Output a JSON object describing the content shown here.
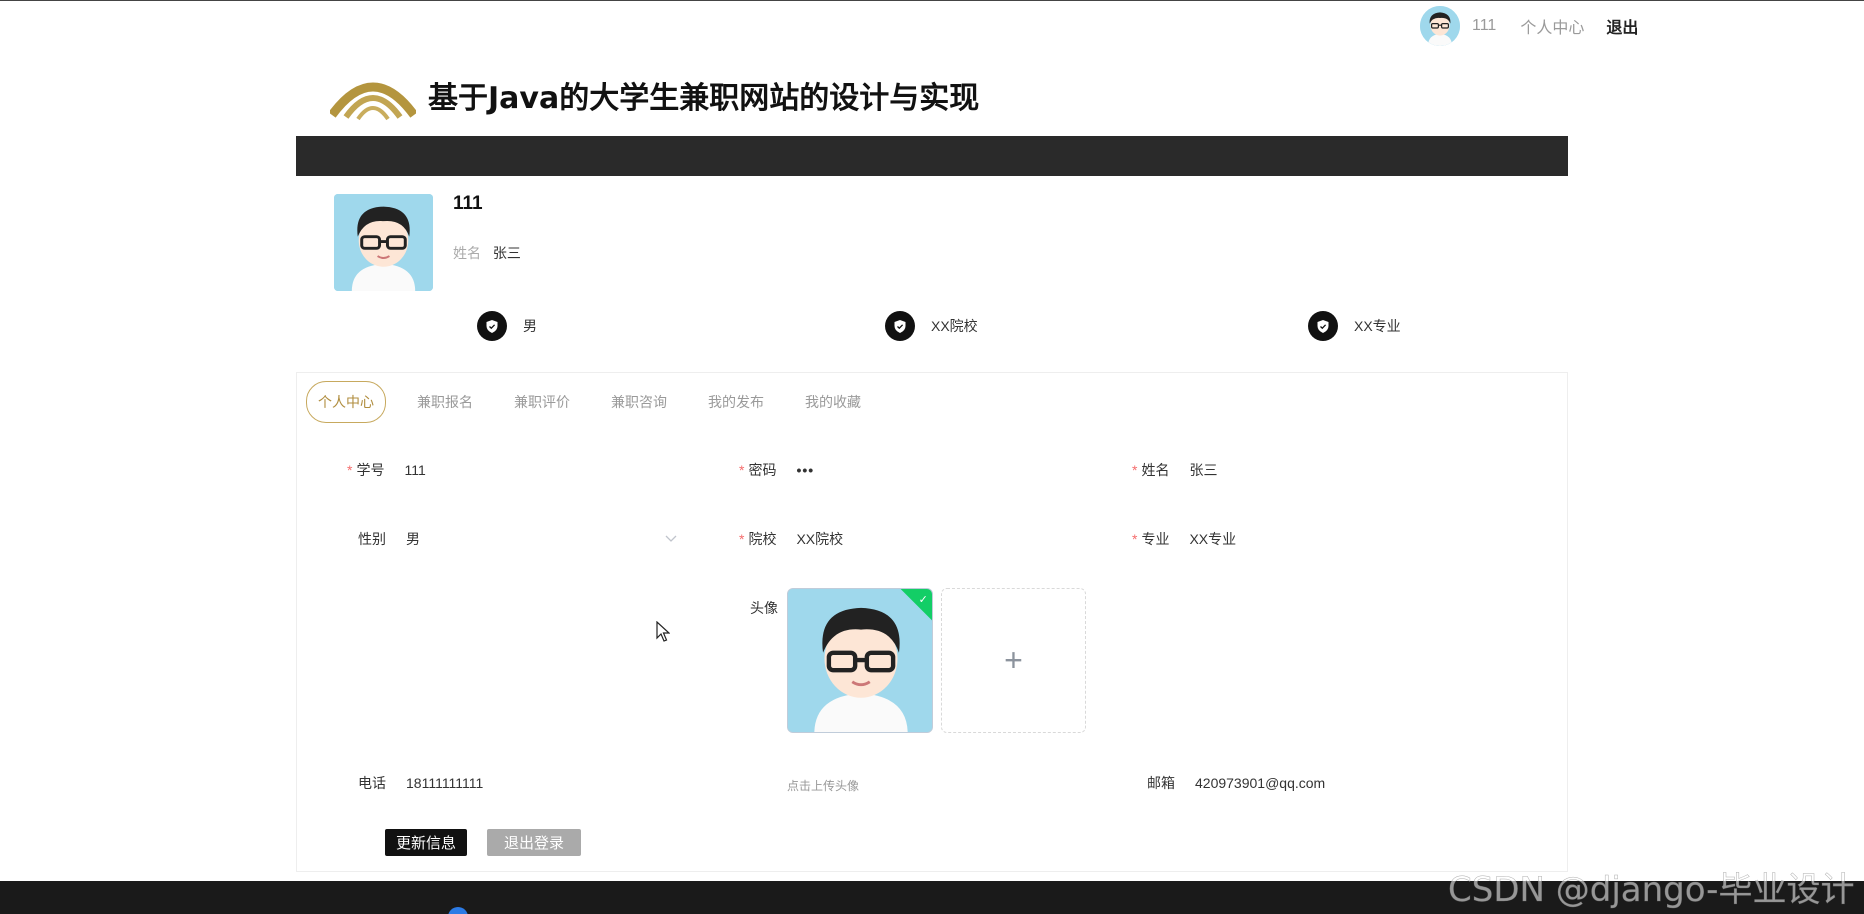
{
  "topbar": {
    "username": "111",
    "user_center": "个人中心",
    "logout": "退出"
  },
  "header": {
    "site_title": "基于Java的大学生兼职网站的设计与实现"
  },
  "profile": {
    "username": "111",
    "name_label": "姓名",
    "name_value": "张三",
    "tags": [
      "男",
      "XX院校",
      "XX专业"
    ]
  },
  "tabs": [
    {
      "label": "个人中心",
      "active": true
    },
    {
      "label": "兼职报名",
      "active": false
    },
    {
      "label": "兼职评价",
      "active": false
    },
    {
      "label": "兼职咨询",
      "active": false
    },
    {
      "label": "我的发布",
      "active": false
    },
    {
      "label": "我的收藏",
      "active": false
    }
  ],
  "form": {
    "student_id": {
      "label": "学号",
      "value": "111",
      "required": true
    },
    "password": {
      "label": "密码",
      "value": "•••",
      "required": true
    },
    "name": {
      "label": "姓名",
      "value": "张三",
      "required": true
    },
    "gender": {
      "label": "性别",
      "value": "男",
      "required": false
    },
    "school": {
      "label": "院校",
      "value": "XX院校",
      "required": true
    },
    "major": {
      "label": "专业",
      "value": "XX专业",
      "required": true
    },
    "avatar": {
      "label": "头像",
      "tip": "点击上传头像"
    },
    "phone": {
      "label": "电话",
      "value": "18111111111"
    },
    "email": {
      "label": "邮箱",
      "value": "420973901@qq.com"
    }
  },
  "buttons": {
    "update": "更新信息",
    "logout": "退出登录"
  },
  "watermark": "CSDN @django-毕业设计",
  "colors": {
    "accent": "#b08d3e",
    "navbar": "#2a2a2a",
    "success": "#13ce66",
    "required": "#f56c6c"
  },
  "icons": [
    "avatar",
    "logo-arc-icon",
    "shield-icon",
    "chevron-down-icon",
    "check-icon",
    "plus-icon",
    "cursor-icon"
  ]
}
